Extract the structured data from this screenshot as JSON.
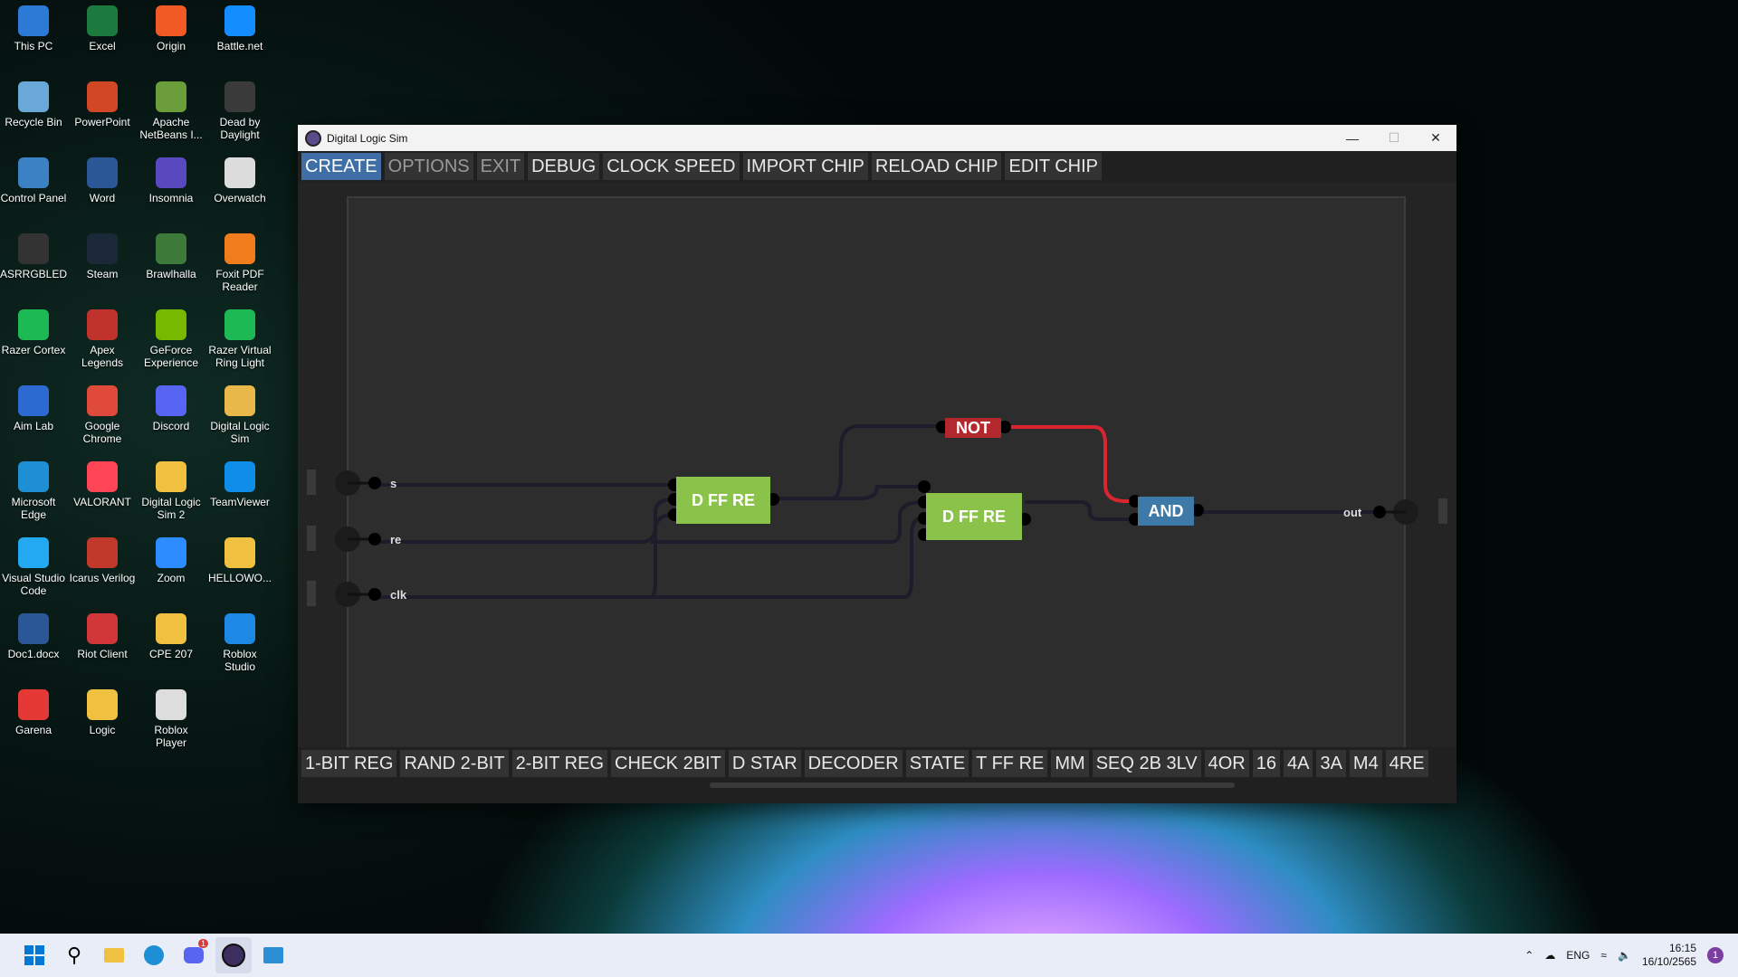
{
  "desktop": {
    "icons": [
      {
        "label": "This PC",
        "icon": "computer-icon",
        "color": "#2b7bd6"
      },
      {
        "label": "Excel",
        "icon": "excel-icon",
        "color": "#1d7a3f"
      },
      {
        "label": "Origin",
        "icon": "origin-icon",
        "color": "#f15a24"
      },
      {
        "label": "Battle.net",
        "icon": "battlenet-icon",
        "color": "#148eff"
      },
      {
        "label": "Recycle Bin",
        "icon": "recycle-bin-icon",
        "color": "#6aa8d8"
      },
      {
        "label": "PowerPoint",
        "icon": "powerpoint-icon",
        "color": "#d24726"
      },
      {
        "label": "Apache NetBeans I...",
        "icon": "netbeans-icon",
        "color": "#6b9d3a"
      },
      {
        "label": "Dead by Daylight",
        "icon": "dbd-icon",
        "color": "#3a3a3a"
      },
      {
        "label": "Control Panel",
        "icon": "control-panel-icon",
        "color": "#3b82c4"
      },
      {
        "label": "Word",
        "icon": "word-icon",
        "color": "#2b5797"
      },
      {
        "label": "Insomnia",
        "icon": "insomnia-icon",
        "color": "#5849be"
      },
      {
        "label": "Overwatch",
        "icon": "overwatch-icon",
        "color": "#dcdcdc"
      },
      {
        "label": "ASRRGBLED",
        "icon": "asrock-icon",
        "color": "#333333"
      },
      {
        "label": "Steam",
        "icon": "steam-icon",
        "color": "#1b2838"
      },
      {
        "label": "Brawlhalla",
        "icon": "brawlhalla-icon",
        "color": "#3e7a3a"
      },
      {
        "label": "Foxit PDF Reader",
        "icon": "foxit-icon",
        "color": "#f07c1d"
      },
      {
        "label": "Razer Cortex",
        "icon": "razer-icon",
        "color": "#1db954"
      },
      {
        "label": "Apex Legends",
        "icon": "apex-icon",
        "color": "#c0322c"
      },
      {
        "label": "GeForce Experience",
        "icon": "geforce-icon",
        "color": "#76b900"
      },
      {
        "label": "Razer Virtual Ring Light",
        "icon": "razer-ring-icon",
        "color": "#1db954"
      },
      {
        "label": "Aim Lab",
        "icon": "aimlab-icon",
        "color": "#2c6ad2"
      },
      {
        "label": "Google Chrome",
        "icon": "chrome-icon",
        "color": "#e04a3a"
      },
      {
        "label": "Discord",
        "icon": "discord-icon",
        "color": "#5865f2"
      },
      {
        "label": "Digital Logic Sim",
        "icon": "folder-icon",
        "color": "#e8b84a"
      },
      {
        "label": "Microsoft Edge",
        "icon": "edge-icon",
        "color": "#1e8fd4"
      },
      {
        "label": "VALORANT",
        "icon": "valorant-icon",
        "color": "#fd4556"
      },
      {
        "label": "Digital Logic Sim 2",
        "icon": "folder-icon",
        "color": "#f0c040"
      },
      {
        "label": "TeamViewer",
        "icon": "teamviewer-icon",
        "color": "#0e8ee9"
      },
      {
        "label": "Visual Studio Code",
        "icon": "vscode-icon",
        "color": "#23a9f2"
      },
      {
        "label": "Icarus Verilog",
        "icon": "icarus-icon",
        "color": "#c0392b"
      },
      {
        "label": "Zoom",
        "icon": "zoom-icon",
        "color": "#2d8cff"
      },
      {
        "label": "HELLOWO...",
        "icon": "folder-icon",
        "color": "#f0c040"
      },
      {
        "label": "Doc1.docx",
        "icon": "docx-icon",
        "color": "#2b5797"
      },
      {
        "label": "Riot Client",
        "icon": "riot-icon",
        "color": "#d13639"
      },
      {
        "label": "CPE 207",
        "icon": "folder-icon",
        "color": "#f0c040"
      },
      {
        "label": "Roblox Studio",
        "icon": "roblox-studio-icon",
        "color": "#1e88e5"
      },
      {
        "label": "Garena",
        "icon": "garena-icon",
        "color": "#e53935"
      },
      {
        "label": "Logic",
        "icon": "folder-icon",
        "color": "#f0c040"
      },
      {
        "label": "Roblox Player",
        "icon": "roblox-icon",
        "color": "#dddddd"
      }
    ]
  },
  "window": {
    "title": "Digital Logic Sim",
    "menu": [
      "CREATE",
      "OPTIONS",
      "EXIT",
      "DEBUG",
      "CLOCK SPEED",
      "IMPORT CHIP",
      "RELOAD CHIP",
      "EDIT CHIP"
    ],
    "inputs": [
      "s",
      "re",
      "clk"
    ],
    "output": "out",
    "chips": {
      "dff1": "D FF RE",
      "dff2": "D FF RE",
      "not": "NOT",
      "and": "AND"
    },
    "chip_colors": {
      "dff": "#8bc34a",
      "not": "#b3282d",
      "and": "#3d7aa8"
    },
    "chip_bar": [
      "1-BIT REG",
      "RAND 2-BIT",
      "2-BIT REG",
      "CHECK 2BIT",
      "D STAR",
      "DECODER",
      "STATE",
      "T FF RE",
      "MM",
      "SEQ 2B 3LV",
      "4OR",
      "16",
      "4A",
      "3A",
      "M4",
      "4RE"
    ]
  },
  "taskbar": {
    "apps": [
      "start-icon",
      "search-icon",
      "file-explorer-icon",
      "edge-icon",
      "discord-icon",
      "digital-logic-sim-icon",
      "photos-icon"
    ],
    "discord_badge": "1",
    "language": "ENG",
    "time": "16:15",
    "date": "16/10/2565",
    "notification_count": "1"
  }
}
